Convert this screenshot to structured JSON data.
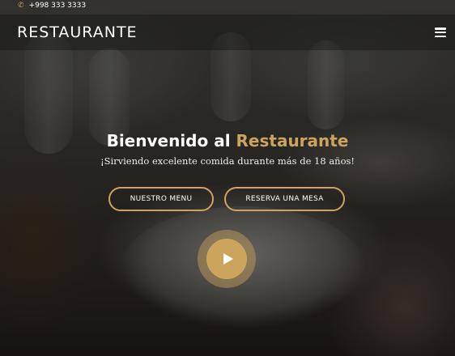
{
  "topbar": {
    "phone": "+998 333 3333",
    "phone_icon": "phone-icon"
  },
  "header": {
    "logo": "RESTAURANTE",
    "menu_icon": "hamburger-icon"
  },
  "hero": {
    "title_prefix": "Bienvenido al ",
    "title_accent": "Restaurante",
    "subtitle": "¡Sirviendo excelente comida durante más de 18 años!",
    "btn_menu": "NUESTRO MENU",
    "btn_book": "RESERVA UNA MESA",
    "play_icon": "play-icon"
  },
  "colors": {
    "accent": "#cda45e",
    "text": "#ffffff"
  }
}
